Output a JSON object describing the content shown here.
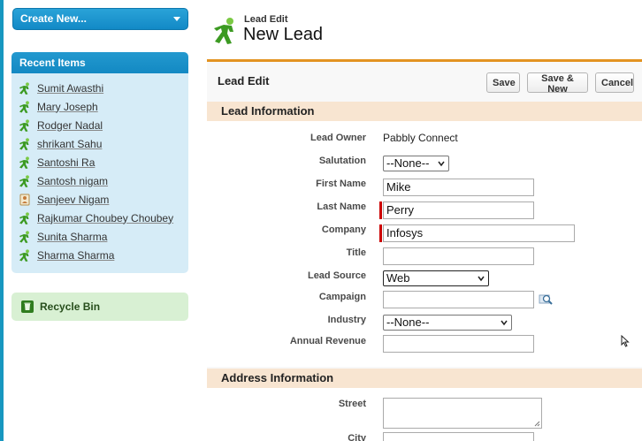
{
  "sidebar": {
    "create_new": "Create New...",
    "recent_items": {
      "title": "Recent Items",
      "items": [
        {
          "label": "Sumit Awasthi",
          "icon": "lead-icon"
        },
        {
          "label": "Mary Joseph",
          "icon": "lead-icon"
        },
        {
          "label": "Rodger Nadal",
          "icon": "lead-icon"
        },
        {
          "label": "shrikant Sahu",
          "icon": "lead-icon"
        },
        {
          "label": "Santoshi Ra",
          "icon": "lead-icon"
        },
        {
          "label": "Santosh nigam",
          "icon": "lead-icon"
        },
        {
          "label": "Sanjeev Nigam",
          "icon": "contact-card-icon"
        },
        {
          "label": "Rajkumar Choubey Choubey",
          "icon": "lead-icon"
        },
        {
          "label": "Sunita Sharma",
          "icon": "lead-icon"
        },
        {
          "label": "Sharma Sharma",
          "icon": "lead-icon"
        }
      ]
    },
    "recycle_bin": "Recycle Bin"
  },
  "header": {
    "type_label": "Lead Edit",
    "title": "New Lead"
  },
  "panel": {
    "title": "Lead Edit",
    "buttons": {
      "save": "Save",
      "save_new": "Save & New",
      "cancel": "Cancel"
    },
    "lead_information": {
      "title": "Lead Information",
      "fields": {
        "lead_owner": {
          "label": "Lead Owner",
          "value": "Pabbly Connect"
        },
        "salutation": {
          "label": "Salutation",
          "value": "--None--"
        },
        "first_name": {
          "label": "First Name",
          "value": "Mike"
        },
        "last_name": {
          "label": "Last Name",
          "value": "Perry"
        },
        "company": {
          "label": "Company",
          "value": "Infosys"
        },
        "title": {
          "label": "Title",
          "value": ""
        },
        "lead_source": {
          "label": "Lead Source",
          "value": "Web"
        },
        "campaign": {
          "label": "Campaign",
          "value": ""
        },
        "industry": {
          "label": "Industry",
          "value": "--None--"
        },
        "annual_revenue": {
          "label": "Annual Revenue",
          "value": ""
        }
      }
    },
    "address_information": {
      "title": "Address Information",
      "fields": {
        "street": {
          "label": "Street",
          "value": ""
        },
        "city": {
          "label": "City",
          "value": ""
        }
      }
    }
  },
  "colors": {
    "accent_orange": "#e39321",
    "sidebar_blue": "#1389c3",
    "required_red": "#cc0000",
    "section_bg": "#f8e5d1"
  }
}
